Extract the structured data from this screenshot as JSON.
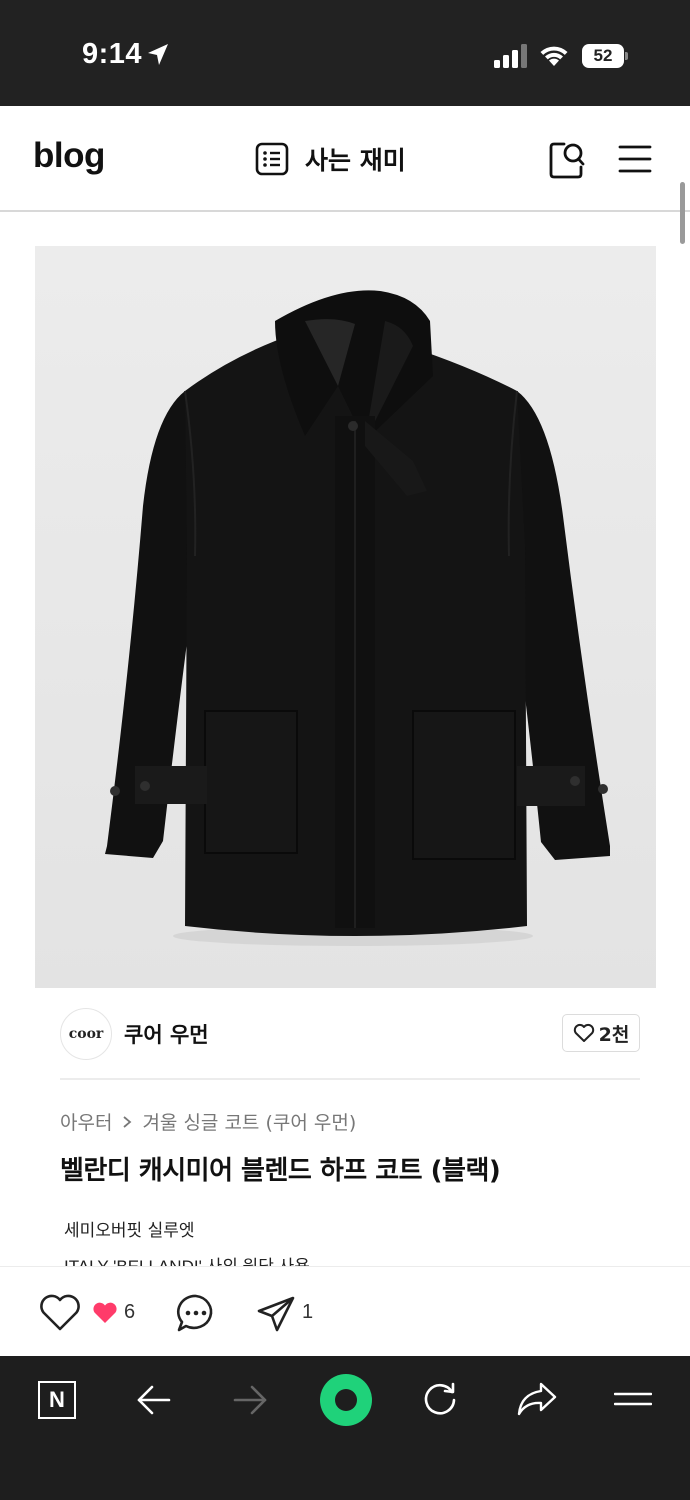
{
  "status_bar": {
    "time": "9:14",
    "battery": "52"
  },
  "header": {
    "logo": "blog",
    "category": "사는 재미"
  },
  "brand": {
    "logo_text": "coor",
    "name": "쿠어 우먼",
    "likes": "2천"
  },
  "product": {
    "breadcrumb": [
      "아우터",
      "겨울 싱글 코트 (쿠어 우먼)"
    ],
    "title": "벨란디 캐시미어 블렌드 하프 코트 (블랙)",
    "description": [
      "세미오버핏 실루엣",
      "ITALY 'BELLANDI' 사의 원단 사용"
    ]
  },
  "actions": {
    "like_count": "6",
    "share_count": "1"
  },
  "browser": {
    "n_label": "N"
  },
  "colors": {
    "status_bg": "#222222",
    "browser_bg": "#1e1e1e",
    "naver_green": "#1fd27a",
    "heart_pink": "#ff3b6a"
  }
}
